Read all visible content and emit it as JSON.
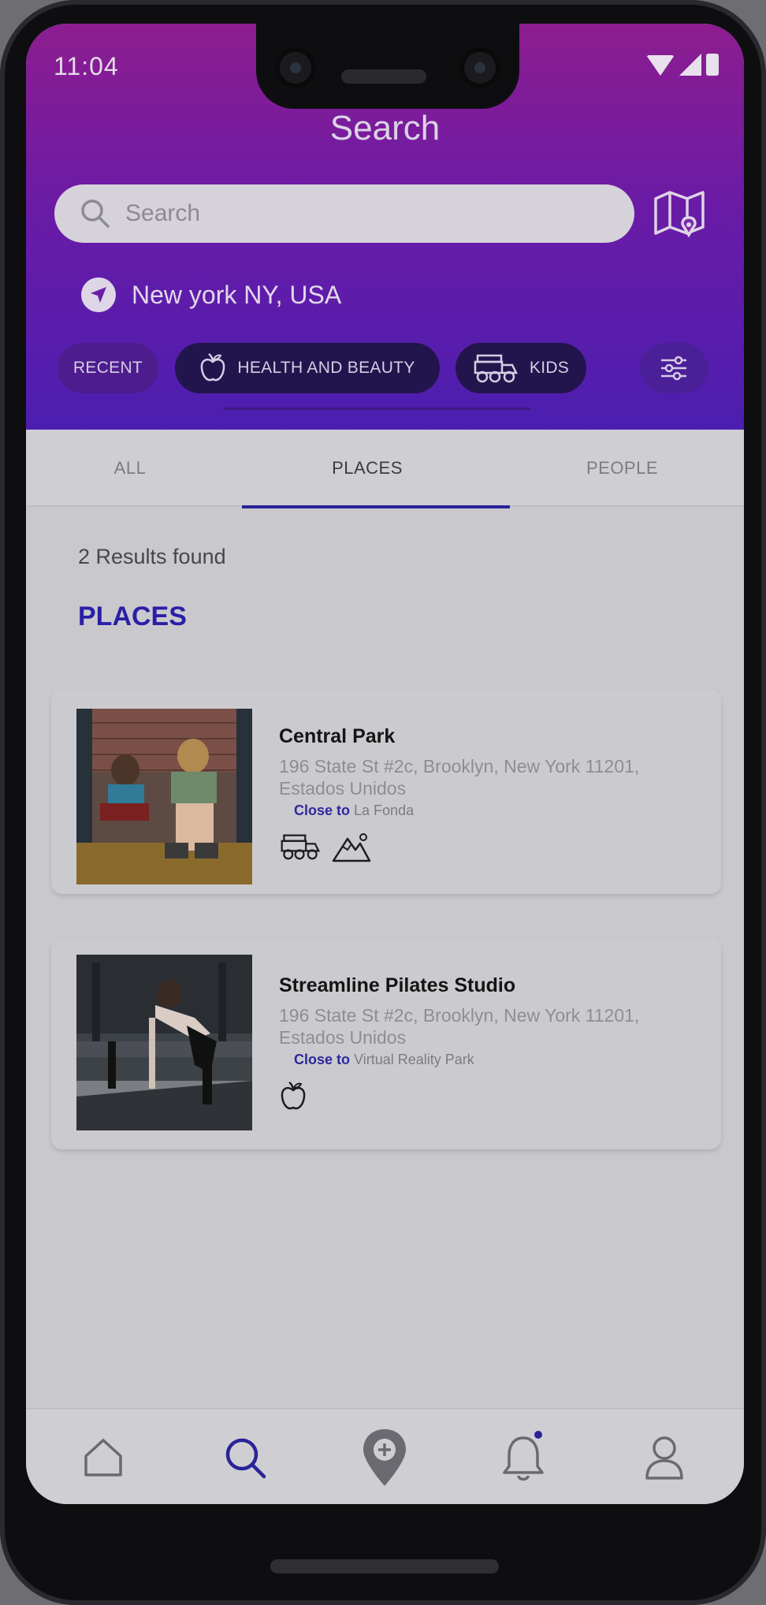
{
  "status_bar": {
    "time": "11:04"
  },
  "header": {
    "title": "Search",
    "search": {
      "placeholder": "Search",
      "value": ""
    },
    "location": "New york NY, USA"
  },
  "chips": [
    {
      "label": "RECENT"
    },
    {
      "label": "HEALTH AND BEAUTY",
      "icon": "apple-icon"
    },
    {
      "label": "KIDS",
      "icon": "train-icon"
    }
  ],
  "tabs": [
    {
      "label": "ALL"
    },
    {
      "label": "PLACES",
      "selected": true
    },
    {
      "label": "PEOPLE"
    }
  ],
  "results_text": "2 Results found",
  "section_title": "PLACES",
  "places": [
    {
      "name": "Central Park",
      "address": "196 State St #2c, Brooklyn, New York 11201, Estados Unidos",
      "close_label": "Close to",
      "close_to": "La Fonda",
      "icons": [
        "train-icon",
        "mountain-icon"
      ]
    },
    {
      "name": "Streamline Pilates Studio",
      "address": "196 State St #2c, Brooklyn, New York 11201, Estados Unidos",
      "close_label": "Close to",
      "close_to": "Virtual Reality Park",
      "icons": [
        "apple-icon"
      ]
    }
  ],
  "bottom_nav": [
    {
      "icon": "home-icon"
    },
    {
      "icon": "search-icon",
      "active": true
    },
    {
      "icon": "add-location-icon"
    },
    {
      "icon": "bell-icon",
      "badge": true
    },
    {
      "icon": "profile-icon"
    }
  ],
  "colors": {
    "header_top": "#8d1d8f",
    "header_bottom": "#4c1eb0",
    "accent": "#2a1fa6",
    "chip_dark": "#22154d"
  }
}
